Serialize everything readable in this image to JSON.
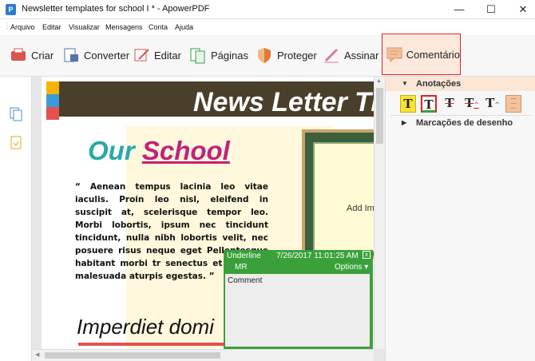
{
  "window": {
    "title": "Newsletter templates for school I * - ApowerPDF",
    "app_icon": "P"
  },
  "winbtns": {
    "minimize": "—",
    "maximize": "☐",
    "close": "✕"
  },
  "menu": [
    "Arquivo",
    "Editar",
    "Visualizar",
    "Mensagens",
    "Conta",
    "Ajuda"
  ],
  "toolbar": {
    "criar": "Criar",
    "converter": "Converter",
    "editar": "Editar",
    "paginas": "Páginas",
    "proteger": "Proteger",
    "assinar": "Assinar",
    "comentario": "Comentário"
  },
  "page": {
    "news_title": "News Letter Ti",
    "our": "Our",
    "school": "School",
    "paragraph": "“ Aenean tempus lacinia leo vitae iaculis. Proin leo nisl, eleifend in suscipit at, scelerisque tempor leo. Morbi lobortis, ipsum nec tincidunt tincidunt, nulla nibh lobortis velit, nec posuere risus neque eget Pellentesque habitant morbi tr senectus et netus et malesuada aturpis egestas. ”",
    "imperdiet": "Imperdiet domi",
    "add_image": "Add Im"
  },
  "comment": {
    "type": "Underline",
    "datetime": "7/26/2017 11:01:25 AM",
    "author": "MR",
    "options": "Options ▾",
    "body": "Comment",
    "close": "x"
  },
  "panel": {
    "anotacoes": "Anotações",
    "marcacoes": "Marcações de desenho",
    "tools": [
      "highlight-text",
      "underline-text",
      "strikethrough-text",
      "replace-text",
      "insert-text",
      "note"
    ]
  },
  "colors": {
    "accent_red": "#e02020",
    "comment_green": "#3aa13a",
    "banner_brown": "#4a3f2a",
    "school_pink": "#c2227a",
    "our_teal": "#2aaaa8"
  }
}
